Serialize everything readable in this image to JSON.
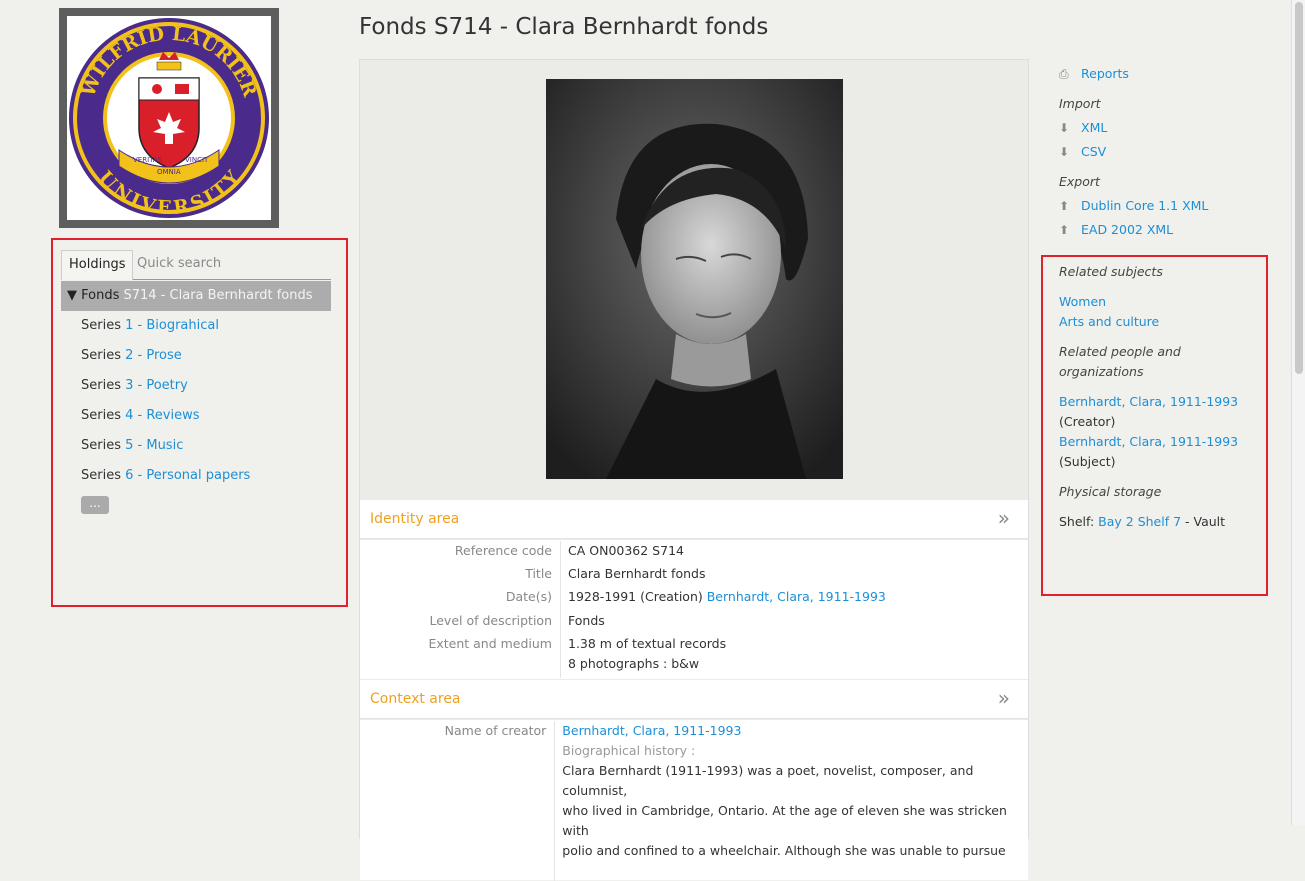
{
  "logo": {
    "top_text": "WILFRID LAURIER",
    "bottom_text": "UNIVERSITY",
    "motto_left": "VERITAS",
    "motto_center": "OMNIA",
    "motto_right": "VINCIT"
  },
  "sidebar": {
    "tabs": [
      {
        "label": "Holdings"
      },
      {
        "label": "Quick search"
      }
    ],
    "tree": {
      "active": {
        "level": "Fonds",
        "title": "S714 - Clara Bernhardt fonds"
      },
      "items": [
        {
          "level": "Series",
          "title": "1 - Biograhical"
        },
        {
          "level": "Series",
          "title": "2 - Prose"
        },
        {
          "level": "Series",
          "title": "3 - Poetry"
        },
        {
          "level": "Series",
          "title": "4 - Reviews"
        },
        {
          "level": "Series",
          "title": "5 - Music"
        },
        {
          "level": "Series",
          "title": "6 - Personal papers"
        }
      ],
      "more_label": "..."
    }
  },
  "page_title": "Fonds S714 - Clara Bernhardt fonds",
  "identity_area": {
    "title": "Identity area",
    "chevron": "»",
    "reference_code_label": "Reference code",
    "reference_code": "CA ON00362 S714",
    "title_label": "Title",
    "title_value": "Clara Bernhardt fonds",
    "dates_label": "Date(s)",
    "dates_value": "1928-1991 (Creation)",
    "dates_link": "Bernhardt, Clara, 1911-1993",
    "level_label": "Level of description",
    "level_value": "Fonds",
    "extent_label": "Extent and medium",
    "extent_line1": "1.38 m of textual records",
    "extent_line2": "8 photographs : b&w"
  },
  "context_area": {
    "title": "Context area",
    "chevron": "»",
    "creator_label": "Name of creator",
    "creator_link": "Bernhardt, Clara, 1911-1993",
    "bio_label": "Biographical history :",
    "bio_line1": "Clara Bernhardt (1911-1993) was a poet, novelist, composer, and columnist,",
    "bio_line2": "who lived in Cambridge, Ontario. At the age of eleven she was stricken with",
    "bio_line3": "polio and confined to a wheelchair. Although she was unable to pursue"
  },
  "right_column": {
    "reports": "Reports",
    "import_head": "Import",
    "import_xml": "XML",
    "import_csv": "CSV",
    "export_head": "Export",
    "export_dc": "Dublin Core 1.1 XML",
    "export_ead": "EAD 2002 XML",
    "related_subjects_head": "Related subjects",
    "subject_1": "Women",
    "subject_2": "Arts and culture",
    "related_people_head_1": "Related people and",
    "related_people_head_2": "organizations",
    "person_1": "Bernhardt, Clara, 1911-1993",
    "person_1_role": "(Creator)",
    "person_2": "Bernhardt, Clara, 1911-1993",
    "person_2_role": "(Subject)",
    "physical_storage_head": "Physical storage",
    "storage_prefix": "Shelf:",
    "storage_link": "Bay 2 Shelf 7",
    "storage_suffix": " - Vault"
  },
  "colors": {
    "link": "#1d8fd6",
    "section_title": "#f0a020",
    "highlight_box": "#e0202a",
    "logo_purple": "#4a2a8a",
    "logo_gold": "#f2c21a"
  }
}
